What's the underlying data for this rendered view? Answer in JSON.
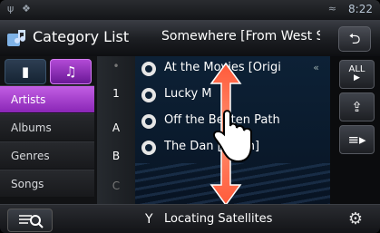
{
  "status_bar": {
    "time": "8:22"
  },
  "header": {
    "title": "Category List",
    "now_playing": "Somewhere [From West S",
    "back_icon": "back-arrow-icon"
  },
  "media_tabs": [
    {
      "name": "video",
      "icon": "film-icon"
    },
    {
      "name": "music",
      "icon": "music-note-icon",
      "active": true
    }
  ],
  "categories": [
    {
      "label": "Artists",
      "selected": true
    },
    {
      "label": "Albums"
    },
    {
      "label": "Genres"
    },
    {
      "label": "Songs"
    }
  ],
  "index": {
    "letters": [
      "1",
      "A",
      "B",
      "C"
    ]
  },
  "list": {
    "items": [
      {
        "label": "At the Movies [Origi",
        "extra": "«"
      },
      {
        "label": "Lucky M"
      },
      {
        "label": "Off the Beaten Path"
      },
      {
        "label": "The Dan [Japan]"
      }
    ]
  },
  "right_buttons": [
    {
      "label": "ALL",
      "icon": "play-all-icon"
    },
    {
      "label": "",
      "icon": "folder-up-icon"
    },
    {
      "label": "",
      "icon": "list-play-icon"
    }
  ],
  "footer": {
    "status_text": "Locating Satellites",
    "icons": [
      "search-list-icon",
      "satellite-icon",
      "gear-icon"
    ]
  },
  "colors": {
    "accent": "#b24ad6",
    "list_bg": "#0d2136"
  }
}
